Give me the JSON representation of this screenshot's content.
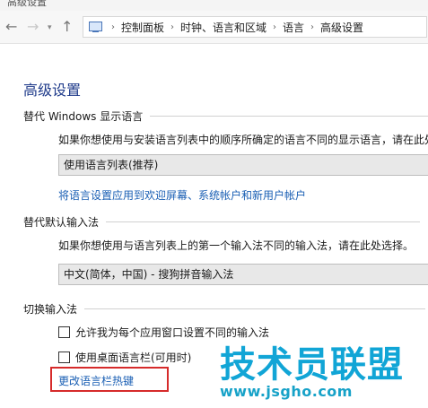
{
  "window": {
    "title": "高级设置"
  },
  "nav": {
    "back_icon": "back-arrow-icon",
    "forward_icon": "forward-arrow-icon",
    "up_icon": "up-arrow-icon",
    "breadcrumb": [
      "控制面板",
      "时钟、语言和区域",
      "语言",
      "高级设置"
    ]
  },
  "page": {
    "title": "高级设置"
  },
  "display_language": {
    "heading": "替代 Windows 显示语言",
    "description": "如果你想使用与安装语言列表中的顺序所确定的语言不同的显示语言，请在此处",
    "selected": "使用语言列表(推荐)",
    "apply_link": "将语言设置应用到欢迎屏幕、系统帐户和新用户帐户"
  },
  "input_method": {
    "heading": "替代默认输入法",
    "description": "如果你想使用与语言列表上的第一个输入法不同的输入法，请在此处选择。",
    "selected": "中文(简体，中国) - 搜狗拼音输入法"
  },
  "switch_input": {
    "heading": "切换输入法",
    "option1": "允许我为每个应用窗口设置不同的输入法",
    "option2": "使用桌面语言栏(可用时)",
    "hotkey_link": "更改语言栏热键"
  },
  "watermark": {
    "title": "技术员联盟",
    "url": "www.jsgho.com"
  },
  "colors": {
    "link": "#1a5fb4",
    "heading": "#1e3a8a",
    "highlight": "#d62b2b",
    "watermark": "#11a5d6"
  }
}
